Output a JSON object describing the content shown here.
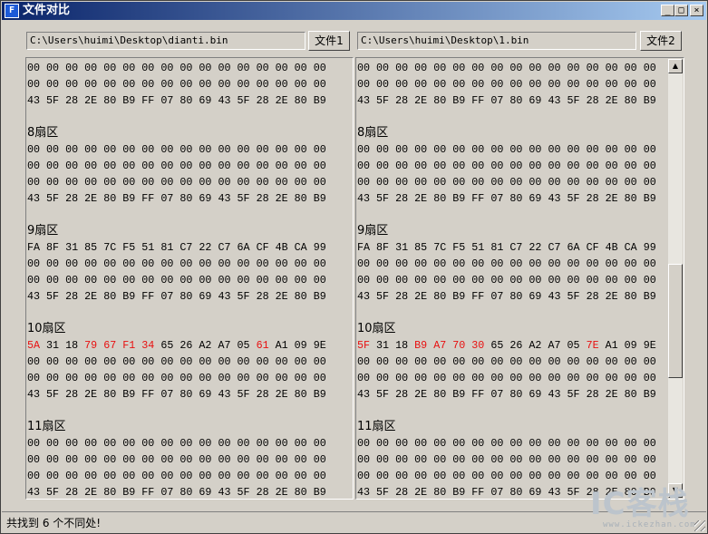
{
  "window": {
    "title": "文件对比",
    "icon_glyph": "F",
    "controls": {
      "minimize": "_",
      "maximize": "□",
      "close": "×"
    }
  },
  "file1": {
    "path": "C:\\Users\\huimi\\Desktop\\dianti.bin",
    "button_label": "文件1"
  },
  "file2": {
    "path": "C:\\Users\\huimi\\Desktop\\1.bin",
    "button_label": "文件2"
  },
  "colors": {
    "diff": "#e81010",
    "text": "#000000",
    "panel_bg": "#d4d0c8"
  },
  "left_lines": [
    {
      "type": "hex",
      "bytes": [
        "00",
        "00",
        "00",
        "00",
        "00",
        "00",
        "00",
        "00",
        "00",
        "00",
        "00",
        "00",
        "00",
        "00",
        "00",
        "00"
      ]
    },
    {
      "type": "hex",
      "bytes": [
        "00",
        "00",
        "00",
        "00",
        "00",
        "00",
        "00",
        "00",
        "00",
        "00",
        "00",
        "00",
        "00",
        "00",
        "00",
        "00"
      ]
    },
    {
      "type": "hex",
      "bytes": [
        "43",
        "5F",
        "28",
        "2E",
        "80",
        "B9",
        "FF",
        "07",
        "80",
        "69",
        "43",
        "5F",
        "28",
        "2E",
        "80",
        "B9"
      ]
    },
    {
      "type": "blank"
    },
    {
      "type": "label",
      "text": "8扇区"
    },
    {
      "type": "hex",
      "bytes": [
        "00",
        "00",
        "00",
        "00",
        "00",
        "00",
        "00",
        "00",
        "00",
        "00",
        "00",
        "00",
        "00",
        "00",
        "00",
        "00"
      ]
    },
    {
      "type": "hex",
      "bytes": [
        "00",
        "00",
        "00",
        "00",
        "00",
        "00",
        "00",
        "00",
        "00",
        "00",
        "00",
        "00",
        "00",
        "00",
        "00",
        "00"
      ]
    },
    {
      "type": "hex",
      "bytes": [
        "00",
        "00",
        "00",
        "00",
        "00",
        "00",
        "00",
        "00",
        "00",
        "00",
        "00",
        "00",
        "00",
        "00",
        "00",
        "00"
      ]
    },
    {
      "type": "hex",
      "bytes": [
        "43",
        "5F",
        "28",
        "2E",
        "80",
        "B9",
        "FF",
        "07",
        "80",
        "69",
        "43",
        "5F",
        "28",
        "2E",
        "80",
        "B9"
      ]
    },
    {
      "type": "blank"
    },
    {
      "type": "label",
      "text": "9扇区"
    },
    {
      "type": "hex",
      "bytes": [
        "FA",
        "8F",
        "31",
        "85",
        "7C",
        "F5",
        "51",
        "81",
        "C7",
        "22",
        "C7",
        "6A",
        "CF",
        "4B",
        "CA",
        "99"
      ]
    },
    {
      "type": "hex",
      "bytes": [
        "00",
        "00",
        "00",
        "00",
        "00",
        "00",
        "00",
        "00",
        "00",
        "00",
        "00",
        "00",
        "00",
        "00",
        "00",
        "00"
      ]
    },
    {
      "type": "hex",
      "bytes": [
        "00",
        "00",
        "00",
        "00",
        "00",
        "00",
        "00",
        "00",
        "00",
        "00",
        "00",
        "00",
        "00",
        "00",
        "00",
        "00"
      ]
    },
    {
      "type": "hex",
      "bytes": [
        "43",
        "5F",
        "28",
        "2E",
        "80",
        "B9",
        "FF",
        "07",
        "80",
        "69",
        "43",
        "5F",
        "28",
        "2E",
        "80",
        "B9"
      ]
    },
    {
      "type": "blank"
    },
    {
      "type": "label",
      "text": "10扇区"
    },
    {
      "type": "hex",
      "bytes": [
        "5A",
        "31",
        "18",
        "79",
        "67",
        "F1",
        "34",
        "65",
        "26",
        "A2",
        "A7",
        "05",
        "61",
        "A1",
        "09",
        "9E"
      ],
      "diff": [
        0,
        3,
        4,
        5,
        6,
        12
      ]
    },
    {
      "type": "hex",
      "bytes": [
        "00",
        "00",
        "00",
        "00",
        "00",
        "00",
        "00",
        "00",
        "00",
        "00",
        "00",
        "00",
        "00",
        "00",
        "00",
        "00"
      ]
    },
    {
      "type": "hex",
      "bytes": [
        "00",
        "00",
        "00",
        "00",
        "00",
        "00",
        "00",
        "00",
        "00",
        "00",
        "00",
        "00",
        "00",
        "00",
        "00",
        "00"
      ]
    },
    {
      "type": "hex",
      "bytes": [
        "43",
        "5F",
        "28",
        "2E",
        "80",
        "B9",
        "FF",
        "07",
        "80",
        "69",
        "43",
        "5F",
        "28",
        "2E",
        "80",
        "B9"
      ]
    },
    {
      "type": "blank"
    },
    {
      "type": "label",
      "text": "11扇区"
    },
    {
      "type": "hex",
      "bytes": [
        "00",
        "00",
        "00",
        "00",
        "00",
        "00",
        "00",
        "00",
        "00",
        "00",
        "00",
        "00",
        "00",
        "00",
        "00",
        "00"
      ]
    },
    {
      "type": "hex",
      "bytes": [
        "00",
        "00",
        "00",
        "00",
        "00",
        "00",
        "00",
        "00",
        "00",
        "00",
        "00",
        "00",
        "00",
        "00",
        "00",
        "00"
      ]
    },
    {
      "type": "hex",
      "bytes": [
        "00",
        "00",
        "00",
        "00",
        "00",
        "00",
        "00",
        "00",
        "00",
        "00",
        "00",
        "00",
        "00",
        "00",
        "00",
        "00"
      ]
    },
    {
      "type": "hex",
      "bytes": [
        "43",
        "5F",
        "28",
        "2E",
        "80",
        "B9",
        "FF",
        "07",
        "80",
        "69",
        "43",
        "5F",
        "28",
        "2E",
        "80",
        "B9"
      ]
    }
  ],
  "right_lines": [
    {
      "type": "hex",
      "bytes": [
        "00",
        "00",
        "00",
        "00",
        "00",
        "00",
        "00",
        "00",
        "00",
        "00",
        "00",
        "00",
        "00",
        "00",
        "00",
        "00"
      ]
    },
    {
      "type": "hex",
      "bytes": [
        "00",
        "00",
        "00",
        "00",
        "00",
        "00",
        "00",
        "00",
        "00",
        "00",
        "00",
        "00",
        "00",
        "00",
        "00",
        "00"
      ]
    },
    {
      "type": "hex",
      "bytes": [
        "43",
        "5F",
        "28",
        "2E",
        "80",
        "B9",
        "FF",
        "07",
        "80",
        "69",
        "43",
        "5F",
        "28",
        "2E",
        "80",
        "B9"
      ]
    },
    {
      "type": "blank"
    },
    {
      "type": "label",
      "text": "8扇区"
    },
    {
      "type": "hex",
      "bytes": [
        "00",
        "00",
        "00",
        "00",
        "00",
        "00",
        "00",
        "00",
        "00",
        "00",
        "00",
        "00",
        "00",
        "00",
        "00",
        "00"
      ]
    },
    {
      "type": "hex",
      "bytes": [
        "00",
        "00",
        "00",
        "00",
        "00",
        "00",
        "00",
        "00",
        "00",
        "00",
        "00",
        "00",
        "00",
        "00",
        "00",
        "00"
      ]
    },
    {
      "type": "hex",
      "bytes": [
        "00",
        "00",
        "00",
        "00",
        "00",
        "00",
        "00",
        "00",
        "00",
        "00",
        "00",
        "00",
        "00",
        "00",
        "00",
        "00"
      ]
    },
    {
      "type": "hex",
      "bytes": [
        "43",
        "5F",
        "28",
        "2E",
        "80",
        "B9",
        "FF",
        "07",
        "80",
        "69",
        "43",
        "5F",
        "28",
        "2E",
        "80",
        "B9"
      ]
    },
    {
      "type": "blank"
    },
    {
      "type": "label",
      "text": "9扇区"
    },
    {
      "type": "hex",
      "bytes": [
        "FA",
        "8F",
        "31",
        "85",
        "7C",
        "F5",
        "51",
        "81",
        "C7",
        "22",
        "C7",
        "6A",
        "CF",
        "4B",
        "CA",
        "99"
      ]
    },
    {
      "type": "hex",
      "bytes": [
        "00",
        "00",
        "00",
        "00",
        "00",
        "00",
        "00",
        "00",
        "00",
        "00",
        "00",
        "00",
        "00",
        "00",
        "00",
        "00"
      ]
    },
    {
      "type": "hex",
      "bytes": [
        "00",
        "00",
        "00",
        "00",
        "00",
        "00",
        "00",
        "00",
        "00",
        "00",
        "00",
        "00",
        "00",
        "00",
        "00",
        "00"
      ]
    },
    {
      "type": "hex",
      "bytes": [
        "43",
        "5F",
        "28",
        "2E",
        "80",
        "B9",
        "FF",
        "07",
        "80",
        "69",
        "43",
        "5F",
        "28",
        "2E",
        "80",
        "B9"
      ]
    },
    {
      "type": "blank"
    },
    {
      "type": "label",
      "text": "10扇区"
    },
    {
      "type": "hex",
      "bytes": [
        "5F",
        "31",
        "18",
        "B9",
        "A7",
        "70",
        "30",
        "65",
        "26",
        "A2",
        "A7",
        "05",
        "7E",
        "A1",
        "09",
        "9E"
      ],
      "diff": [
        0,
        3,
        4,
        5,
        6,
        12
      ]
    },
    {
      "type": "hex",
      "bytes": [
        "00",
        "00",
        "00",
        "00",
        "00",
        "00",
        "00",
        "00",
        "00",
        "00",
        "00",
        "00",
        "00",
        "00",
        "00",
        "00"
      ]
    },
    {
      "type": "hex",
      "bytes": [
        "00",
        "00",
        "00",
        "00",
        "00",
        "00",
        "00",
        "00",
        "00",
        "00",
        "00",
        "00",
        "00",
        "00",
        "00",
        "00"
      ]
    },
    {
      "type": "hex",
      "bytes": [
        "43",
        "5F",
        "28",
        "2E",
        "80",
        "B9",
        "FF",
        "07",
        "80",
        "69",
        "43",
        "5F",
        "28",
        "2E",
        "80",
        "B9"
      ]
    },
    {
      "type": "blank"
    },
    {
      "type": "label",
      "text": "11扇区"
    },
    {
      "type": "hex",
      "bytes": [
        "00",
        "00",
        "00",
        "00",
        "00",
        "00",
        "00",
        "00",
        "00",
        "00",
        "00",
        "00",
        "00",
        "00",
        "00",
        "00"
      ]
    },
    {
      "type": "hex",
      "bytes": [
        "00",
        "00",
        "00",
        "00",
        "00",
        "00",
        "00",
        "00",
        "00",
        "00",
        "00",
        "00",
        "00",
        "00",
        "00",
        "00"
      ]
    },
    {
      "type": "hex",
      "bytes": [
        "00",
        "00",
        "00",
        "00",
        "00",
        "00",
        "00",
        "00",
        "00",
        "00",
        "00",
        "00",
        "00",
        "00",
        "00",
        "00"
      ]
    },
    {
      "type": "hex",
      "bytes": [
        "43",
        "5F",
        "28",
        "2E",
        "80",
        "B9",
        "FF",
        "07",
        "80",
        "69",
        "43",
        "5F",
        "28",
        "2E",
        "80",
        "B9"
      ]
    }
  ],
  "scrollbar": {
    "up_glyph": "▲",
    "down_glyph": "▼"
  },
  "status": {
    "text": "共找到 6 个不同处!"
  },
  "watermark": {
    "main": "IC客栈",
    "sub": "www.ickezhan.com"
  }
}
